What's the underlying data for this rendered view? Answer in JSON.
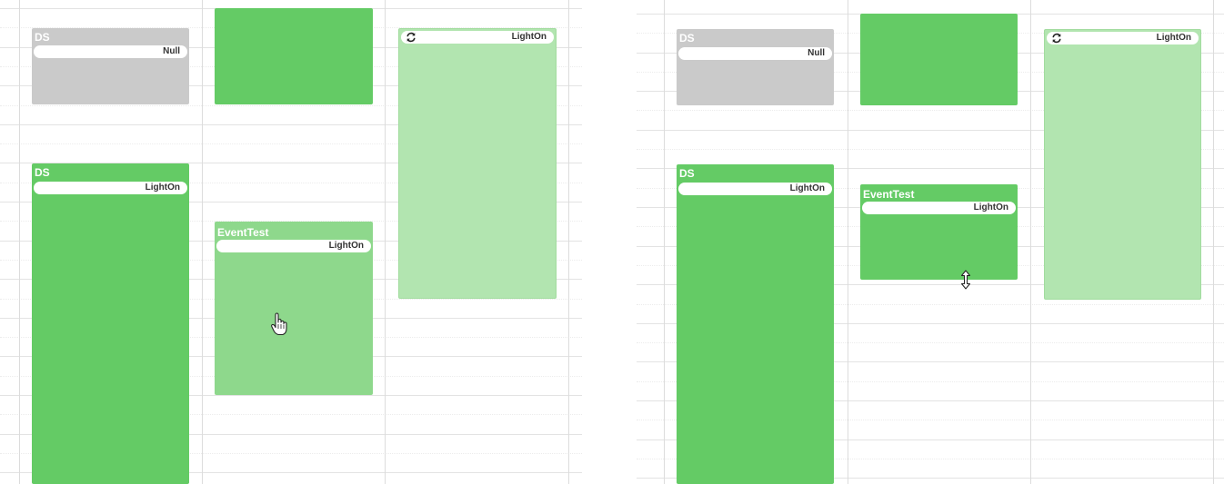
{
  "panels": [
    {
      "events": [
        {
          "title": "DS",
          "status": "Null",
          "refresh_icon": false
        },
        {
          "title": "",
          "status": "",
          "refresh_icon": false
        },
        {
          "title": "",
          "status": "LightOn",
          "refresh_icon": true
        },
        {
          "title": "DS",
          "status": "LightOn",
          "refresh_icon": false
        },
        {
          "title": "EventTest",
          "status": "LightOn",
          "refresh_icon": false
        }
      ],
      "cursor": "hand-pointer-cursor"
    },
    {
      "events": [
        {
          "title": "DS",
          "status": "Null",
          "refresh_icon": false
        },
        {
          "title": "",
          "status": "",
          "refresh_icon": false
        },
        {
          "title": "",
          "status": "LightOn",
          "refresh_icon": true
        },
        {
          "title": "DS",
          "status": "LightOn",
          "refresh_icon": false
        },
        {
          "title": "EventTest",
          "status": "LightOn",
          "refresh_icon": false
        }
      ],
      "cursor": "resize-vertical-cursor"
    }
  ],
  "colors": {
    "gray_event": "#cacaca",
    "green_event": "#64cb65",
    "green_event_dragging": "#8ed88c",
    "green_event_light": "#b2e5b0",
    "grid_line": "#e3e3e3"
  }
}
